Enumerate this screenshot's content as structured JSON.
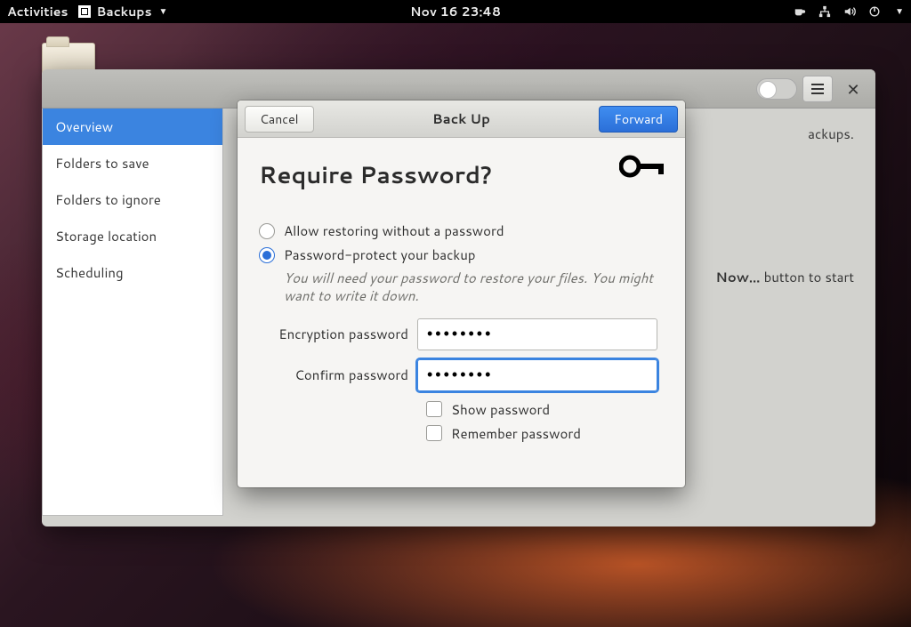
{
  "topbar": {
    "activities": "Activities",
    "app_name": "Backups",
    "datetime": "Nov 16  23:48"
  },
  "window": {
    "sidebar": {
      "items": [
        {
          "label": "Overview",
          "active": true
        },
        {
          "label": "Folders to save",
          "active": false
        },
        {
          "label": "Folders to ignore",
          "active": false
        },
        {
          "label": "Storage location",
          "active": false
        },
        {
          "label": "Scheduling",
          "active": false
        }
      ]
    },
    "main": {
      "line1_suffix": "ackups.",
      "line2_prefix": "Now…",
      "line2_suffix": " button to start"
    }
  },
  "dialog": {
    "cancel": "Cancel",
    "title": "Back Up",
    "forward": "Forward",
    "heading": "Require Password?",
    "radio_allow": "Allow restoring without a password",
    "radio_protect": "Password-protect your backup",
    "note": "You will need your password to restore your files. You might want to write it down.",
    "enc_label": "Encryption password",
    "conf_label": "Confirm password",
    "enc_value": "••••••••",
    "conf_value": "••••••••",
    "show_pw": "Show password",
    "remember_pw": "Remember password"
  }
}
